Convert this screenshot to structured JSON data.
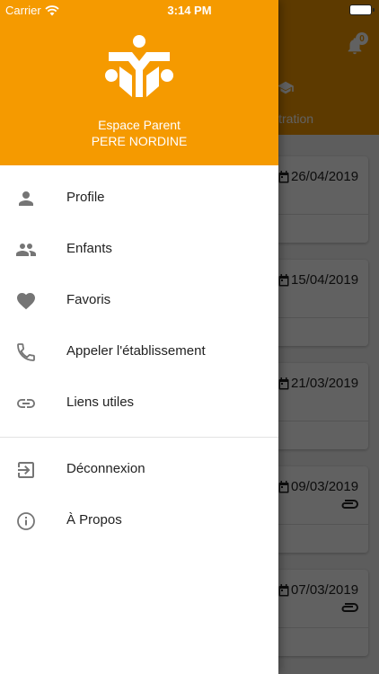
{
  "status_bar": {
    "carrier": "Carrier",
    "time": "3:14 PM"
  },
  "background": {
    "notification_count": "0",
    "tab_label": "istration",
    "cards": [
      {
        "date": "26/04/2019",
        "has_attachment": false
      },
      {
        "date": "15/04/2019",
        "has_attachment": false
      },
      {
        "date": "21/03/2019",
        "has_attachment": false
      },
      {
        "date": "09/03/2019",
        "has_attachment": true
      },
      {
        "date": "07/03/2019",
        "has_attachment": true
      }
    ]
  },
  "drawer": {
    "title": "Espace Parent",
    "subtitle": "PERE NORDINE",
    "menu": [
      {
        "label": "Profile",
        "icon": "person-icon"
      },
      {
        "label": "Enfants",
        "icon": "people-icon"
      },
      {
        "label": "Favoris",
        "icon": "heart-icon"
      },
      {
        "label": "Appeler l'établissement",
        "icon": "phone-icon"
      },
      {
        "label": "Liens utiles",
        "icon": "link-icon"
      }
    ],
    "menu_secondary": [
      {
        "label": "Déconnexion",
        "icon": "logout-icon"
      },
      {
        "label": "À Propos",
        "icon": "info-icon"
      }
    ]
  },
  "colors": {
    "accent": "#f59a00",
    "icon": "#757575",
    "text": "#222222"
  }
}
